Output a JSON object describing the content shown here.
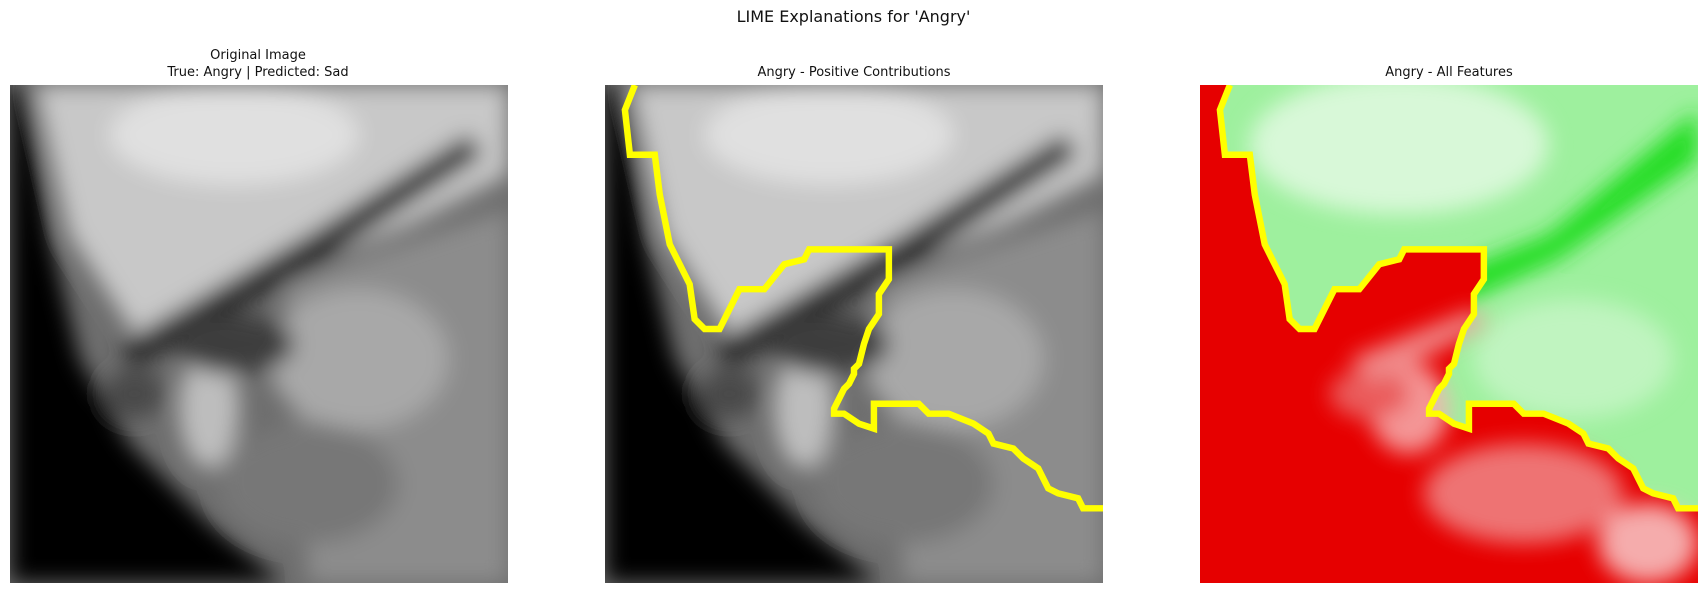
{
  "figure": {
    "suptitle": "LIME Explanations for 'Angry'"
  },
  "panels": [
    {
      "title_line1": "Original Image",
      "title_line2": "True: Angry | Predicted: Sad",
      "kind": "grayscale-face"
    },
    {
      "title": "Angry - Positive Contributions",
      "kind": "grayscale-face-with-boundary"
    },
    {
      "title": "Angry - All Features",
      "kind": "red-green-feature-map"
    }
  ],
  "colors": {
    "boundary": "#ffff00",
    "positive": "#00e000",
    "negative": "#e00000"
  }
}
